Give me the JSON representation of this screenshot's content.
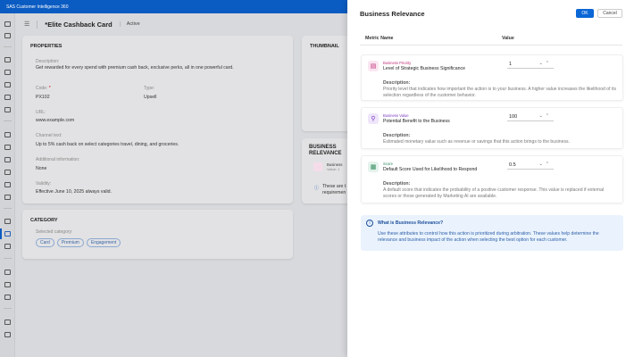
{
  "app": {
    "title": "SAS Customer Intelligence 360"
  },
  "header": {
    "title": "*Elite Cashback Card",
    "status": "Active"
  },
  "properties": {
    "heading": "PROPERTIES",
    "description_label": "Description:",
    "description": "Get rewarded for every spend with premium cash back, exclusive perks, all in one powerful card.",
    "code_label": "Code:",
    "code_required": "*",
    "code": "PX102",
    "type_label": "Type:",
    "type": "Upsell",
    "url_label": "URL:",
    "url": "www.example.com",
    "channel_label": "Channel text:",
    "channel": "Up to 5% cash back on select categories travel, dining, and groceries.",
    "additional_label": "Additional information:",
    "additional": "None",
    "validity_label": "Validity:",
    "validity": "Effective June 10, 2025 always valid."
  },
  "category": {
    "heading": "CATEGORY",
    "label": "Selected category:",
    "chips": [
      "Card",
      "Premium",
      "Engagement"
    ]
  },
  "thumbnail": {
    "heading": "THUMBNAIL"
  },
  "business_card": {
    "heading": "BUSINESS RELEVANCE",
    "item": "Business",
    "item_value": "Value: 1",
    "note": "These are t",
    "note2": "requiremen"
  },
  "modal": {
    "title": "Business Relevance",
    "ok": "OK",
    "cancel": "Cancel",
    "col_metric": "Metric Name",
    "col_value": "Value",
    "metrics": [
      {
        "category": "Business Priority",
        "name": "Level of Strategic Business Significance",
        "value": "1",
        "desc_label": "Description:",
        "desc": "Priority level that indicates how important the action is to your business. A higher value increases the likelihood of its selection regardless of the customer behavior.",
        "color": "#c2307a",
        "bg": "#fbe6f1",
        "icon": "priority-icon"
      },
      {
        "category": "Business Value",
        "name": "Potential Benefit to the Business",
        "value": "100",
        "desc_label": "Description:",
        "desc": "Estimated monetary value such as revenue or savings that this action brings to the business.",
        "color": "#7a3bc2",
        "bg": "#efe6fb",
        "icon": "value-icon"
      },
      {
        "category": "Score",
        "name": "Default Score Used for Likelihood to Respond",
        "value": "0.5",
        "desc_label": "Description:",
        "desc": "A default score that indicates the probability of a positive customer response. This value is replaced if external scores or those generated by Marketing AI are available.",
        "color": "#2f8a5c",
        "bg": "#e4f3ec",
        "icon": "score-icon"
      }
    ],
    "info_title": "What is Business Relevance?",
    "info_body": "Use these attributes to control how this action is prioritized during arbitration. These values help determine the relevance and business impact of the action when selecting the best option for each customer."
  }
}
